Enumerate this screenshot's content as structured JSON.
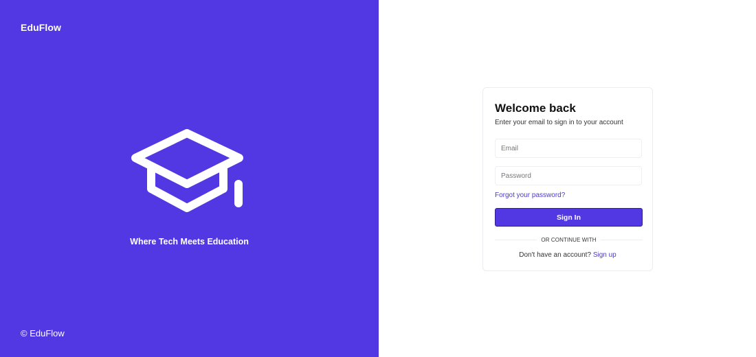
{
  "brand": {
    "logo_text": "EduFlow",
    "tagline": "Where Tech Meets Education",
    "copyright": "© EduFlow",
    "accent_color": "#5238e2",
    "icon": "graduation-cap-icon"
  },
  "login": {
    "title": "Welcome back",
    "subtitle": "Enter your email to sign in to your account",
    "email_placeholder": "Email",
    "password_placeholder": "Password",
    "forgot_label": "Forgot your password?",
    "signin_label": "Sign In",
    "divider_label": "OR CONTINUE WITH",
    "no_account_text": "Don't have an account?",
    "signup_label": "Sign up"
  }
}
